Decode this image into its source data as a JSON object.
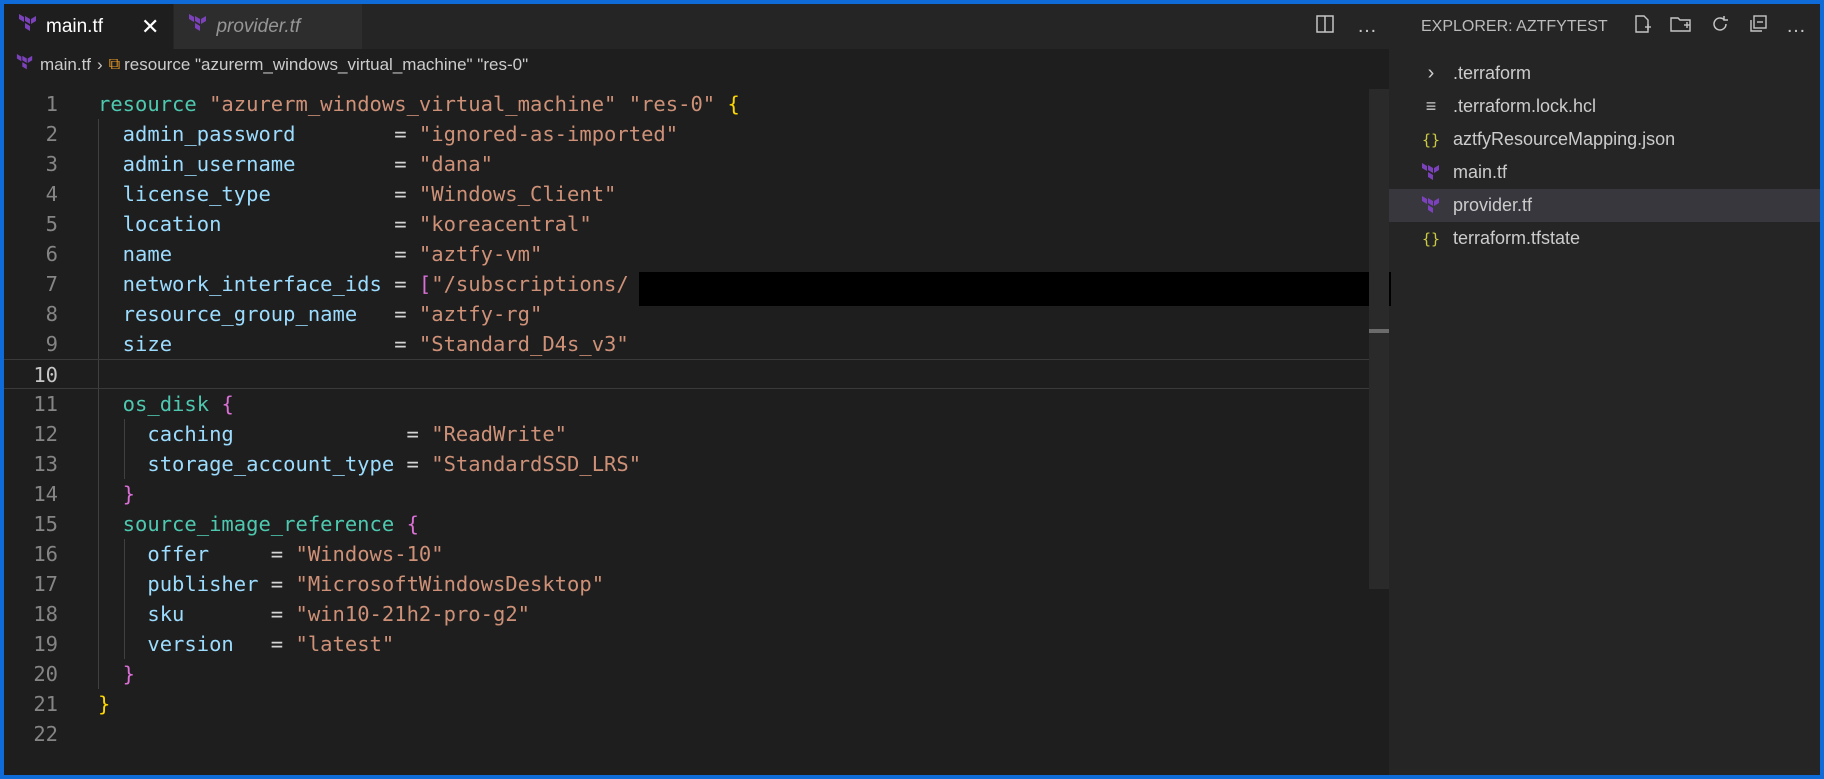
{
  "tabs": [
    {
      "label": "main.tf",
      "active": true
    },
    {
      "label": "provider.tf",
      "active": false
    }
  ],
  "tab_close": "✕",
  "editor_actions": {
    "split": "split-editor-icon",
    "more": "…"
  },
  "breadcrumb": {
    "file": "main.tf",
    "symbol": "resource \"azurerm_windows_virtual_machine\" \"res-0\""
  },
  "code": {
    "lines": [
      {
        "n": "1",
        "parts": [
          [
            "kw",
            "resource"
          ],
          [
            "op",
            " "
          ],
          [
            "str",
            "\"azurerm_windows_virtual_machine\""
          ],
          [
            "op",
            " "
          ],
          [
            "str",
            "\"res-0\""
          ],
          [
            "op",
            " "
          ],
          [
            "br1",
            "{"
          ]
        ]
      },
      {
        "n": "2",
        "parts": [
          [
            "attr",
            "  admin_password"
          ],
          [
            "op",
            "        = "
          ],
          [
            "str",
            "\"ignored-as-imported\""
          ]
        ]
      },
      {
        "n": "3",
        "parts": [
          [
            "attr",
            "  admin_username"
          ],
          [
            "op",
            "        = "
          ],
          [
            "str",
            "\"dana\""
          ]
        ]
      },
      {
        "n": "4",
        "parts": [
          [
            "attr",
            "  license_type"
          ],
          [
            "op",
            "          = "
          ],
          [
            "str",
            "\"Windows_Client\""
          ]
        ]
      },
      {
        "n": "5",
        "parts": [
          [
            "attr",
            "  location"
          ],
          [
            "op",
            "              = "
          ],
          [
            "str",
            "\"koreacentral\""
          ]
        ]
      },
      {
        "n": "6",
        "parts": [
          [
            "attr",
            "  name"
          ],
          [
            "op",
            "                  = "
          ],
          [
            "str",
            "\"aztfy-vm\""
          ]
        ]
      },
      {
        "n": "7",
        "parts": [
          [
            "attr",
            "  network_interface_ids"
          ],
          [
            "op",
            " = "
          ],
          [
            "br2",
            "["
          ],
          [
            "str",
            "\"/subscriptions/"
          ]
        ]
      },
      {
        "n": "8",
        "parts": [
          [
            "attr",
            "  resource_group_name"
          ],
          [
            "op",
            "   = "
          ],
          [
            "str",
            "\"aztfy-rg\""
          ]
        ]
      },
      {
        "n": "9",
        "parts": [
          [
            "attr",
            "  size"
          ],
          [
            "op",
            "                  = "
          ],
          [
            "str",
            "\"Standard_D4s_v3\""
          ]
        ]
      },
      {
        "n": "10",
        "parts": [],
        "current": true
      },
      {
        "n": "11",
        "parts": [
          [
            "kw",
            "  os_disk"
          ],
          [
            "op",
            " "
          ],
          [
            "br2",
            "{"
          ]
        ]
      },
      {
        "n": "12",
        "parts": [
          [
            "attr",
            "    caching"
          ],
          [
            "op",
            "              = "
          ],
          [
            "str",
            "\"ReadWrite\""
          ]
        ]
      },
      {
        "n": "13",
        "parts": [
          [
            "attr",
            "    storage_account_type"
          ],
          [
            "op",
            " = "
          ],
          [
            "str",
            "\"StandardSSD_LRS\""
          ]
        ]
      },
      {
        "n": "14",
        "parts": [
          [
            "br2",
            "  }"
          ]
        ]
      },
      {
        "n": "15",
        "parts": [
          [
            "kw",
            "  source_image_reference"
          ],
          [
            "op",
            " "
          ],
          [
            "br2",
            "{"
          ]
        ]
      },
      {
        "n": "16",
        "parts": [
          [
            "attr",
            "    offer"
          ],
          [
            "op",
            "     = "
          ],
          [
            "str",
            "\"Windows-10\""
          ]
        ]
      },
      {
        "n": "17",
        "parts": [
          [
            "attr",
            "    publisher"
          ],
          [
            "op",
            " = "
          ],
          [
            "str",
            "\"MicrosoftWindowsDesktop\""
          ]
        ]
      },
      {
        "n": "18",
        "parts": [
          [
            "attr",
            "    sku"
          ],
          [
            "op",
            "       = "
          ],
          [
            "str",
            "\"win10-21h2-pro-g2\""
          ]
        ]
      },
      {
        "n": "19",
        "parts": [
          [
            "attr",
            "    version"
          ],
          [
            "op",
            "   = "
          ],
          [
            "str",
            "\"latest\""
          ]
        ]
      },
      {
        "n": "20",
        "parts": [
          [
            "br2",
            "  }"
          ]
        ]
      },
      {
        "n": "21",
        "parts": [
          [
            "br1",
            "}"
          ]
        ]
      },
      {
        "n": "22",
        "parts": []
      }
    ]
  },
  "explorer": {
    "title": "EXPLORER: AZTFYTEST",
    "items": [
      {
        "label": ".terraform",
        "icon": "chevron-right-icon",
        "glyph": "›",
        "kind": "folder"
      },
      {
        "label": ".terraform.lock.hcl",
        "icon": "lines-icon",
        "glyph": "≡",
        "kind": "file"
      },
      {
        "label": "aztfyResourceMapping.json",
        "icon": "json-icon",
        "glyph": "{}",
        "kind": "json"
      },
      {
        "label": "main.tf",
        "icon": "terraform-icon",
        "glyph": "",
        "kind": "tf"
      },
      {
        "label": "provider.tf",
        "icon": "terraform-icon",
        "glyph": "",
        "kind": "tf",
        "selected": true
      },
      {
        "label": "terraform.tfstate",
        "icon": "json-icon",
        "glyph": "{}",
        "kind": "json"
      }
    ]
  },
  "colors": {
    "accent": "#0e6bd8",
    "terraform": "#7b42bc"
  }
}
